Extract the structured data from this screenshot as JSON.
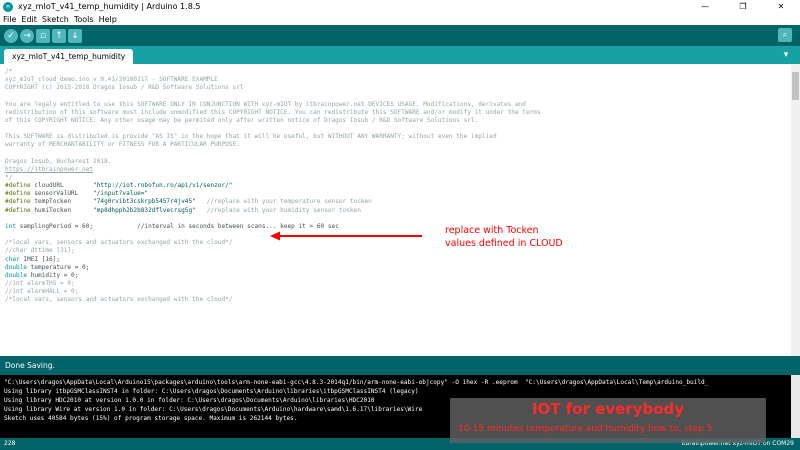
{
  "window": {
    "title": "xyz_mIoT_v41_temp_humidity | Arduino 1.8.5",
    "minimize": "—",
    "maximize": "❐",
    "close": "✕"
  },
  "menu": [
    "File",
    "Edit",
    "Sketch",
    "Tools",
    "Help"
  ],
  "toolbar": {
    "verify_icon": "check-icon",
    "upload_icon": "arrow-right-icon",
    "new_icon": "new-file-icon",
    "open_icon": "arrow-up-icon",
    "save_icon": "arrow-down-icon",
    "serial_monitor_icon": "magnifier-icon"
  },
  "tab": {
    "label": "xyz_mIoT_v41_temp_humidity",
    "menu_icon": "chevron-down-icon"
  },
  "code_lines": [
    {
      "cls": "c-cmt",
      "text": "/*"
    },
    {
      "cls": "c-cmt",
      "text": "xyz_mIoT_cloud_demo.ino v 0.41/20180217 - SOFTWARE EXAMPLE"
    },
    {
      "cls": "c-cmt",
      "text": "COPYRIGHT (c) 2015-2018 Dragos Iosub / R&D Software Solutions srl"
    },
    {
      "cls": "c-cmt",
      "text": ""
    },
    {
      "cls": "c-cmt",
      "text": "You are legaly entitled to use this SOFTWARE ONLY IN CONJUNCTION WITH xyz-mIOT by itbrainpower.net DEVICES USAGE. Modifications, derivates and"
    },
    {
      "cls": "c-cmt",
      "text": "redistribution of this software must include unmodified this COPYRIGHT NOTICE. You can redistribute this SOFTWARE and/or modify it under the terms"
    },
    {
      "cls": "c-cmt",
      "text": "of this COPYRIGHT NOTICE. Any other usage may be permited only after written notice of Dragos Iosub / R&D Software Solutions srl."
    },
    {
      "cls": "c-cmt",
      "text": ""
    },
    {
      "cls": "c-cmt",
      "text": "This SOFTWARE is distributed is provide \"AS IS\" in the hope that it will be useful, but WITHOUT ANY WARRANTY; without even the implied"
    },
    {
      "cls": "c-cmt",
      "text": "warranty of MERCHANTABILITY or FITNESS FOR A PARTICULAR PURPOSE."
    },
    {
      "cls": "c-cmt",
      "text": ""
    },
    {
      "cls": "c-cmt",
      "text": "Dragos Iosub, Bucharest 2018."
    },
    {
      "cls": "c-link",
      "text": "https://itbrainpower.net"
    },
    {
      "cls": "c-cmt",
      "text": "*/"
    },
    {
      "cls": "mixed",
      "parts": [
        {
          "cls": "c-pre",
          "text": "#define"
        },
        {
          "cls": "c-txt",
          "text": " cloudURL        "
        },
        {
          "cls": "c-str",
          "text": "\"http://iot.robofun.ro/api/v1/senzor/\""
        }
      ]
    },
    {
      "cls": "mixed",
      "parts": [
        {
          "cls": "c-pre",
          "text": "#define"
        },
        {
          "cls": "c-txt",
          "text": " sensorValURL    "
        },
        {
          "cls": "c-str",
          "text": "\"/input?value=\""
        }
      ]
    },
    {
      "cls": "mixed",
      "parts": [
        {
          "cls": "c-pre",
          "text": "#define"
        },
        {
          "cls": "c-txt",
          "text": " tempTocken      "
        },
        {
          "cls": "c-str",
          "text": "\"74g0rvibt3cskrpb5457r4jv45\""
        },
        {
          "cls": "c-cmt",
          "text": "   //replace with your temperature sensor tocken"
        }
      ]
    },
    {
      "cls": "mixed",
      "parts": [
        {
          "cls": "c-pre",
          "text": "#define"
        },
        {
          "cls": "c-txt",
          "text": " humiTocken      "
        },
        {
          "cls": "c-str",
          "text": "\"mp8dhpph2b2b832dflvecrsg5g\""
        },
        {
          "cls": "c-cmt",
          "text": "   //replace with your humidity sensor tocken"
        }
      ]
    },
    {
      "cls": "c-cmt",
      "text": ""
    },
    {
      "cls": "mixed",
      "parts": [
        {
          "cls": "c-kw",
          "text": "int"
        },
        {
          "cls": "c-txt",
          "text": " samplingPeriod = 60;            "
        },
        {
          "cls": "c-txt",
          "text": "//interval in seconds between scans... keep it > 60 sec"
        }
      ]
    },
    {
      "cls": "c-cmt",
      "text": ""
    },
    {
      "cls": "c-cmt",
      "text": "/*local vars, sensors and actuators exchanged with the cloud*/"
    },
    {
      "cls": "c-cmt",
      "text": "//char dttime [31];"
    },
    {
      "cls": "mixed",
      "parts": [
        {
          "cls": "c-kw",
          "text": "char"
        },
        {
          "cls": "c-txt",
          "text": " IMEI [16];"
        }
      ]
    },
    {
      "cls": "mixed",
      "parts": [
        {
          "cls": "c-kw",
          "text": "double"
        },
        {
          "cls": "c-txt",
          "text": " temperature = 0;"
        }
      ]
    },
    {
      "cls": "mixed",
      "parts": [
        {
          "cls": "c-kw",
          "text": "double"
        },
        {
          "cls": "c-txt",
          "text": " humidity = 0;"
        }
      ]
    },
    {
      "cls": "c-cmt",
      "text": "//int alarmTHS = 0;"
    },
    {
      "cls": "c-cmt",
      "text": "//int alarmHALL = 0;"
    },
    {
      "cls": "c-cmt",
      "text": "/*local vars, sensors and actuators exchanged with the cloud*/"
    },
    {
      "cls": "c-cmt",
      "text": ""
    }
  ],
  "annotation": {
    "line1": "replace with Tocken",
    "line2": "values defined in CLOUD"
  },
  "status": "Done Saving.",
  "console_lines": [
    "\"C:\\Users\\dragos\\AppData\\Local\\Arduino15\\packages\\arduino\\tools\\arm-none-eabi-gcc\\4.8.3-2014q1/bin/arm-none-eabi-objcopy\" -O ihex -R .eeprom  \"C:\\Users\\dragos\\AppData\\Local\\Temp\\arduino_build_",
    "Using library itbpGSMClassINST4 in folder: C:\\Users\\dragos\\Documents\\Arduino\\libraries\\itbpGSMClassINST4 (legacy)",
    "Using library HDC2010 at version 1.0.0 in folder: C:\\Users\\dragos\\Documents\\Arduino\\libraries\\HDC2010",
    "Using library Wire at version 1.0 in folder: C:\\Users\\dragos\\Documents\\Arduino\\hardware\\samd\\1.6.17\\libraries\\Wire",
    "Sketch uses 40584 bytes (15%) of program storage space. Maximum is 262144 bytes."
  ],
  "footer": {
    "line": "228",
    "board": "itbrainpower.net xyz-mIOT on COM29"
  },
  "banner": {
    "title": "IOT for everybody",
    "subtitle": "10-15 minutes temperature and humidity how to, step 5"
  },
  "colors": {
    "toolbar": "#006468",
    "tabbar": "#17a1a5",
    "annotation": "#ff0000"
  }
}
